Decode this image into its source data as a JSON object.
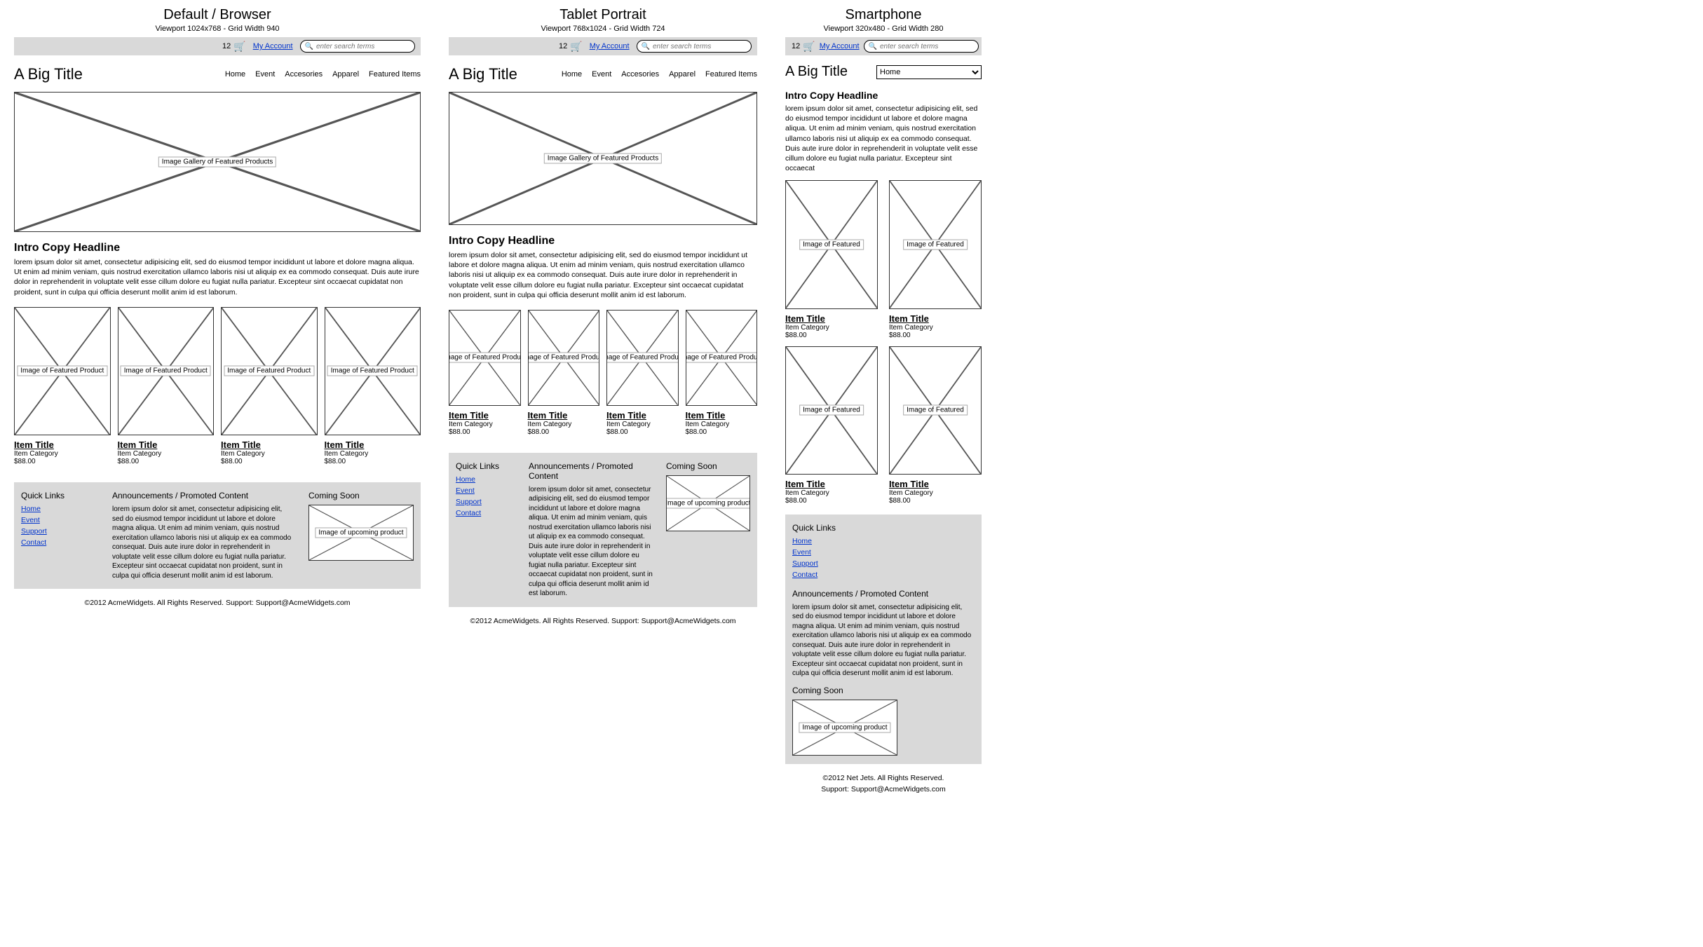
{
  "breakpoints": {
    "desktop": {
      "title": "Default / Browser",
      "meta": "Viewport 1024x768 - Grid Width 940"
    },
    "tablet": {
      "title": "Tablet Portrait",
      "meta": "Viewport 768x1024 - Grid Width 724"
    },
    "phone": {
      "title": "Smartphone",
      "meta": "Viewport 320x480 - Grid Width 280"
    }
  },
  "topbar": {
    "cart_count": "12",
    "account_label": "My Account",
    "search_placeholder": "enter search terms"
  },
  "site_title": "A Big Title",
  "nav_items": [
    "Home",
    "Event",
    "Accesories",
    "Apparel",
    "Featured Items"
  ],
  "nav_select_value": "Home",
  "hero_label": "Image Gallery of Featured Products",
  "intro": {
    "headline": "Intro Copy Headline",
    "copy_long": "lorem ipsum dolor sit amet, consectetur adipisicing elit, sed do eiusmod tempor incididunt ut labore et dolore magna aliqua. Ut enim ad minim veniam, quis nostrud exercitation ullamco laboris nisi ut aliquip ex ea commodo consequat. Duis aute irure dolor in reprehenderit in voluptate velit esse cillum dolore eu fugiat nulla pariatur. Excepteur sint occaecat cupidatat non proident, sunt in culpa qui officia deserunt mollit anim id est laborum.",
    "copy_phone": "lorem ipsum dolor sit amet, consectetur adipisicing elit, sed do eiusmod tempor incididunt ut labore et dolore magna aliqua. Ut enim ad minim veniam, quis nostrud exercitation ullamco laboris nisi ut aliquip ex ea commodo consequat. Duis aute irure dolor in reprehenderit in voluptate velit esse cillum dolore eu fugiat nulla pariatur. Excepteur sint occaecat"
  },
  "product": {
    "img_label": "Image of Featured Product",
    "img_label_short": "Image of Featured",
    "title": "Item Title",
    "category": "Item Category",
    "price": "$88.00"
  },
  "footer": {
    "quicklinks_title": "Quick Links",
    "links": [
      "Home",
      "Event",
      "Support",
      "Contact"
    ],
    "ann_title": "Announcements / Promoted Content",
    "ann_copy": "lorem ipsum dolor sit amet, consectetur adipisicing elit, sed do eiusmod tempor incididunt ut labore et dolore magna aliqua. Ut enim ad minim veniam, quis nostrud exercitation ullamco laboris nisi ut aliquip ex ea commodo consequat. Duis aute irure dolor in reprehenderit in voluptate velit esse cillum dolore eu fugiat nulla pariatur. Excepteur sint occaecat cupidatat non proident, sunt in culpa qui officia deserunt mollit anim id est laborum.",
    "soon_title": "Coming Soon",
    "soon_img_label": "Image of upcoming product"
  },
  "copyright": {
    "acme": "©2012 AcmeWidgets.  All Rights Reserved.  Support: Support@AcmeWidgets.com",
    "netjets_line1": "©2012 Net Jets.  All Rights Reserved.",
    "netjets_line2": "Support: Support@AcmeWidgets.com"
  }
}
